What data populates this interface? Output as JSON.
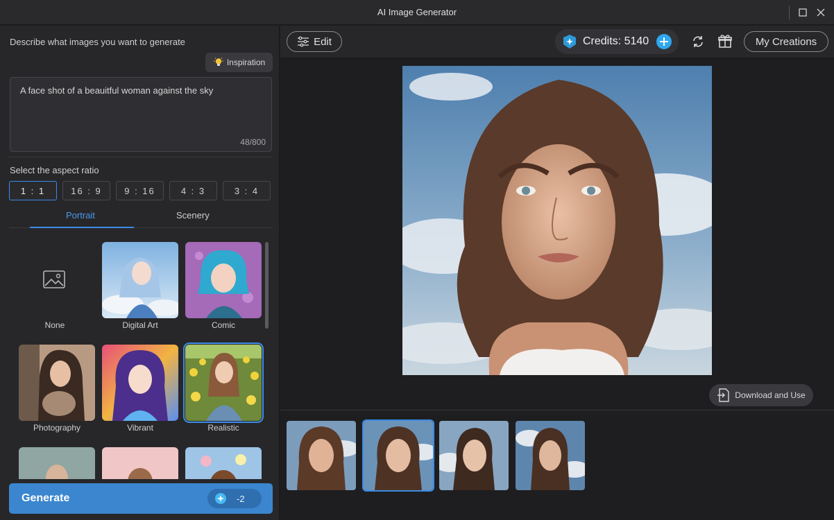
{
  "window": {
    "title": "AI Image Generator"
  },
  "prompt": {
    "label": "Describe what images you want to generate",
    "inspiration_label": "Inspiration",
    "text": "A face shot of a beauitful woman against the sky",
    "char_count": "48/800"
  },
  "aspect": {
    "label": "Select the aspect ratio",
    "options": [
      "1 : 1",
      "16 : 9",
      "9 : 16",
      "4 : 3",
      "3 : 4"
    ],
    "selected": "1 : 1"
  },
  "style_tabs": {
    "portrait": "Portrait",
    "scenery": "Scenery",
    "active": "Portrait"
  },
  "styles": [
    {
      "label": "None",
      "icon": "image-icon"
    },
    {
      "label": "Digital Art"
    },
    {
      "label": "Comic"
    },
    {
      "label": "Photography"
    },
    {
      "label": "Vibrant"
    },
    {
      "label": "Realistic",
      "selected": true
    }
  ],
  "generate": {
    "label": "Generate",
    "cost": "-2"
  },
  "toolbar": {
    "edit_label": "Edit",
    "credits_label": "Credits: 5140",
    "my_creations_label": "My Creations"
  },
  "preview": {
    "download_label": "Download and Use"
  },
  "thumbnails": {
    "count": 4,
    "selected_index": 1
  },
  "colors": {
    "accent": "#3d8be6",
    "generate_bg": "#3b86cf",
    "credits_plus": "#2fa8f0",
    "background": "#1c1c1e"
  }
}
